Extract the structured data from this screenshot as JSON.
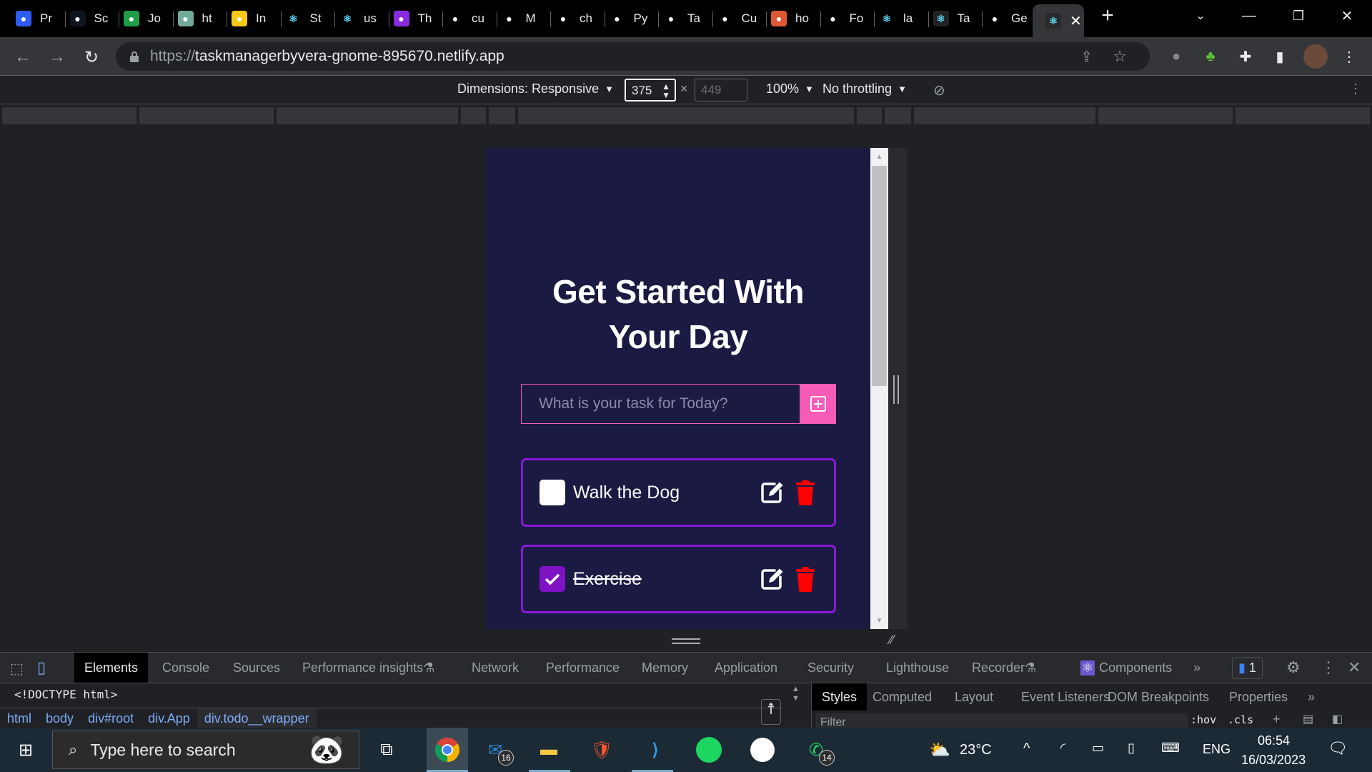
{
  "browser": {
    "tabs": [
      {
        "label": "Pr",
        "icon": "kubernetes-like-icon",
        "color": "#2f5cf5"
      },
      {
        "label": "Sc",
        "icon": "hackerrank-icon",
        "color": "#0e141e"
      },
      {
        "label": "Jo",
        "icon": "plus-green-icon",
        "color": "#1e9e4a"
      },
      {
        "label": "ht",
        "icon": "chatgpt-icon",
        "color": "#74aa9c"
      },
      {
        "label": "In",
        "icon": "yellow-sprite-icon",
        "color": "#f7c815"
      },
      {
        "label": "St",
        "icon": "react-icon",
        "color": "#000"
      },
      {
        "label": "us",
        "icon": "react-icon",
        "color": "#000"
      },
      {
        "label": "Th",
        "icon": "purple-u-icon",
        "color": "#8a2be2"
      },
      {
        "label": "cu",
        "icon": "slash-icon",
        "color": "#000"
      },
      {
        "label": "M",
        "icon": "microsoft-icon",
        "color": "#000"
      },
      {
        "label": "ch",
        "icon": "github-icon",
        "color": "#000"
      },
      {
        "label": "Py",
        "icon": "orange-blocks-icon",
        "color": "#000"
      },
      {
        "label": "Ta",
        "icon": "checkmark-icon",
        "color": "#000"
      },
      {
        "label": "Cu",
        "icon": "cloud-orange-icon",
        "color": "#000"
      },
      {
        "label": "ho",
        "icon": "duckduckgo-icon",
        "color": "#de5833"
      },
      {
        "label": "Fo",
        "icon": "flag-icon",
        "color": "#000"
      },
      {
        "label": "la",
        "icon": "react-icon",
        "color": "#000"
      },
      {
        "label": "Ta",
        "icon": "react-icon",
        "color": "#222"
      },
      {
        "label": "Ge",
        "icon": "teal-diamond-icon",
        "color": "#000"
      }
    ],
    "active_tab_icon": "react-icon",
    "new_tab": "+",
    "url_scheme": "https://",
    "url_host": "taskmanagerbyvera-gnome-895670.netlify.app"
  },
  "device_toolbar": {
    "dimensions_label": "Dimensions: Responsive",
    "width": "375",
    "height": "449",
    "times": "×",
    "zoom": "100%",
    "throttling": "No throttling"
  },
  "app": {
    "title_line1": "Get Started With",
    "title_line2": "Your Day",
    "input_placeholder": "What is your task for Today?",
    "input_value": "",
    "colors": {
      "background": "#1b1a42",
      "accent_pink": "#f65bb7",
      "accent_purple": "#8a19d6",
      "delete_red": "#ff0000"
    },
    "todos": [
      {
        "label": "Walk the Dog",
        "completed": false
      },
      {
        "label": "Exercise",
        "completed": true
      }
    ]
  },
  "devtools": {
    "tabs": [
      "Elements",
      "Console",
      "Sources",
      "Performance insights",
      "Network",
      "Performance",
      "Memory",
      "Application",
      "Security",
      "Lighthouse",
      "Recorder",
      "Components"
    ],
    "active_tab": "Elements",
    "more": "»",
    "issues_count": "1",
    "doctype": "<!DOCTYPE html>",
    "breadcrumb": [
      "html",
      "body",
      "div#root",
      "div.App",
      "div.todo__wrapper"
    ],
    "side_tabs": [
      "Styles",
      "Computed",
      "Layout",
      "Event Listeners",
      "DOM Breakpoints",
      "Properties"
    ],
    "filter_placeholder": "Filter",
    "hov": ":hov",
    "cls": ".cls"
  },
  "taskbar": {
    "search_placeholder": "Type here to search",
    "mail_badge": "16",
    "whatsapp_badge": "14",
    "weather": "23°C",
    "language": "ENG",
    "time": "06:54",
    "date": "16/03/2023"
  }
}
